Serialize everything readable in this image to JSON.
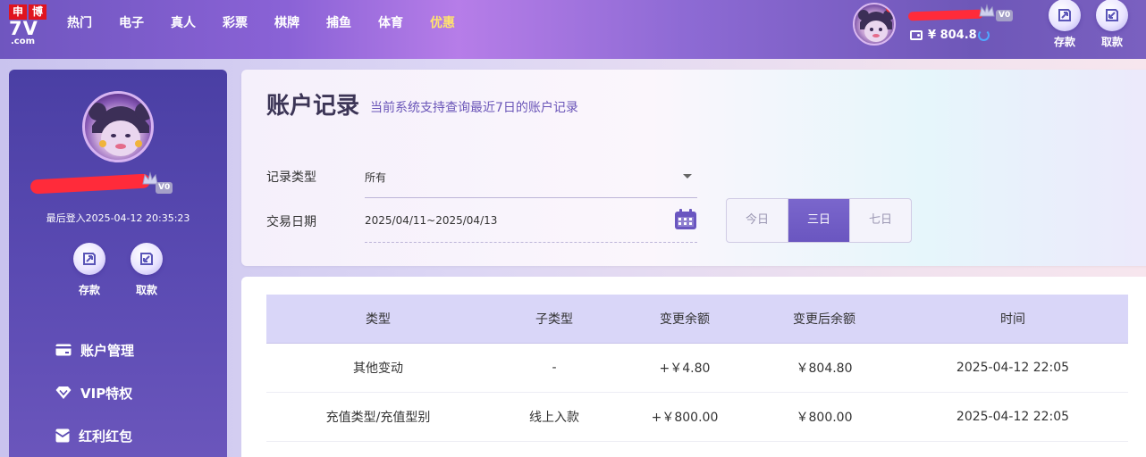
{
  "logo": {
    "cn1": "申",
    "cn2": "博",
    "big": "7V",
    "domain": ".com"
  },
  "nav": [
    {
      "label": "热门"
    },
    {
      "label": "电子"
    },
    {
      "label": "真人"
    },
    {
      "label": "彩票"
    },
    {
      "label": "棋牌"
    },
    {
      "label": "捕鱼"
    },
    {
      "label": "体育"
    },
    {
      "label": "优惠",
      "highlight": true
    }
  ],
  "header": {
    "vip_level": "V0",
    "balance": "¥ 804.8",
    "deposit_label": "存款",
    "withdraw_label": "取款",
    "accent": "#ffe36e"
  },
  "sidebar": {
    "vip_level": "V0",
    "last_login": "最后登入2025-04-12 20:35:23",
    "deposit_label": "存款",
    "withdraw_label": "取款",
    "menu": [
      {
        "label": "账户管理",
        "icon": "card-icon"
      },
      {
        "label": "VIP特权",
        "icon": "diamond-icon"
      },
      {
        "label": "红利红包",
        "icon": "envelope-icon"
      }
    ]
  },
  "filter": {
    "title": "账户记录",
    "subtitle": "当前系统支持查询最近7日的账户记录",
    "type_label": "记录类型",
    "type_value": "所有",
    "date_label": "交易日期",
    "date_value": "2025/04/11~2025/04/13",
    "ranges": [
      {
        "label": "今日",
        "active": false
      },
      {
        "label": "三日",
        "active": true
      },
      {
        "label": "七日",
        "active": false
      }
    ],
    "active_color": "#6a56c0"
  },
  "table": {
    "headers": [
      "类型",
      "子类型",
      "变更余额",
      "变更后余额",
      "时间"
    ],
    "rows": [
      {
        "type": "其他变动",
        "subtype": "-",
        "change": "+￥4.80",
        "after": "￥804.80",
        "time": "2025-04-12 22:05"
      },
      {
        "type": "充值类型/充值型别",
        "subtype": "线上入款",
        "change": "+￥800.00",
        "after": "￥800.00",
        "time": "2025-04-12 22:05"
      }
    ],
    "change_color": "#e4262d",
    "after_color": "#5c59a8"
  }
}
